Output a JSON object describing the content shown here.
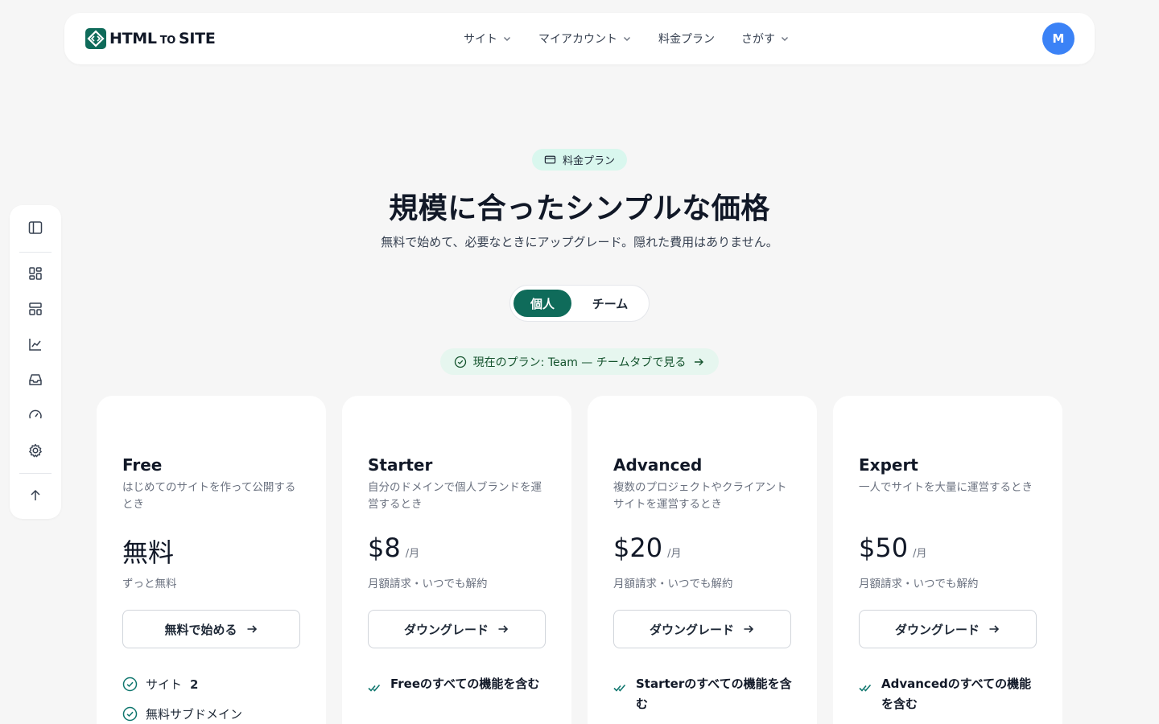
{
  "header": {
    "logo_text_1": "HTML",
    "logo_text_2": "TO",
    "logo_text_3": "SITE",
    "nav": [
      {
        "label": "サイト",
        "has_dropdown": true
      },
      {
        "label": "マイアカウント",
        "has_dropdown": true
      },
      {
        "label": "料金プラン",
        "has_dropdown": false
      },
      {
        "label": "さがす",
        "has_dropdown": true
      }
    ],
    "avatar_initial": "M"
  },
  "sidebar": {
    "icons": [
      "panel-toggle-icon",
      "dashboard-icon",
      "layout-icon",
      "chart-icon",
      "inbox-icon",
      "gauge-icon",
      "gear-icon",
      "arrow-up-icon"
    ]
  },
  "hero": {
    "badge": "料金プラン",
    "title": "規模に合ったシンプルな価格",
    "subtitle": "無料で始めて、必要なときにアップグレード。隠れた費用はありません。"
  },
  "toggle": {
    "options": [
      "個人",
      "チーム"
    ],
    "selected": "個人"
  },
  "current_plan": {
    "text": "現在のプラン: Team — チームタブで見る"
  },
  "plans": [
    {
      "name": "Free",
      "description": "はじめてのサイトを作って公開するとき",
      "price": "無料",
      "unit": "",
      "billing": "ずっと無料",
      "button": "無料で始める",
      "features": [
        {
          "label": "サイト",
          "value": "2"
        },
        {
          "label": "無料サブドメイン",
          "value": ""
        }
      ]
    },
    {
      "name": "Starter",
      "description": "自分のドメインで個人ブランドを運営するとき",
      "price": "$8",
      "unit": "/月",
      "billing": "月額請求・いつでも解約",
      "button": "ダウングレード",
      "includes": "Freeのすべての機能を含む"
    },
    {
      "name": "Advanced",
      "description": "複数のプロジェクトやクライアントサイトを運営するとき",
      "price": "$20",
      "unit": "/月",
      "billing": "月額請求・いつでも解約",
      "button": "ダウングレード",
      "includes": "Starterのすべての機能を含む"
    },
    {
      "name": "Expert",
      "description": "一人でサイトを大量に運営するとき",
      "price": "$50",
      "unit": "/月",
      "billing": "月額請求・いつでも解約",
      "button": "ダウングレード",
      "includes": "Advancedのすべての機能を含む"
    }
  ],
  "colors": {
    "accent": "#0f6b5a",
    "badge_bg": "#d9f7ee",
    "avatar": "#3b82f6",
    "check": "#0f766e"
  }
}
